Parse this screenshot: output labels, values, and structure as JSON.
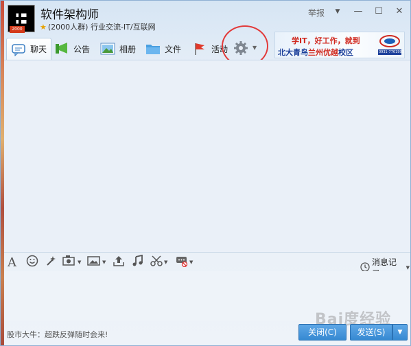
{
  "header": {
    "group_name": "软件架构师",
    "member_info": "(2000人群) 行业交流-IT/互联网",
    "qr_badge_text": "2000",
    "report_label": "举报",
    "controls": [
      "▼",
      "—",
      "☐",
      "✕"
    ]
  },
  "toolbar": {
    "tabs": [
      {
        "label": "聊天",
        "icon": "chat-bubble-icon"
      },
      {
        "label": "公告",
        "icon": "megaphone-icon"
      },
      {
        "label": "相册",
        "icon": "photo-album-icon"
      },
      {
        "label": "文件",
        "icon": "folder-icon"
      },
      {
        "label": "活动",
        "icon": "flag-icon"
      }
    ],
    "more_icon": "gear-icon"
  },
  "ad": {
    "line1": "学IT，好工作，就到",
    "line2_parts": [
      "北大青鸟",
      "兰州优越",
      "校区"
    ],
    "logo_text": "0931-7761993"
  },
  "input_toolbar": {
    "tools": [
      "font-icon",
      "emoji-icon",
      "magic-wand-icon",
      "screenshot-icon",
      "image-icon",
      "upload-icon",
      "music-icon",
      "scissors-icon",
      "record-icon"
    ],
    "history_label": "消息记录"
  },
  "footer": {
    "ticker": "股市大牛：超跌反弹随时会来!",
    "close_label": "关闭(C)",
    "send_label": "发送(S)"
  },
  "watermark": "Bai度经验",
  "colors": {
    "accent": "#3689d2",
    "annotation_circle": "#e23a3a"
  }
}
